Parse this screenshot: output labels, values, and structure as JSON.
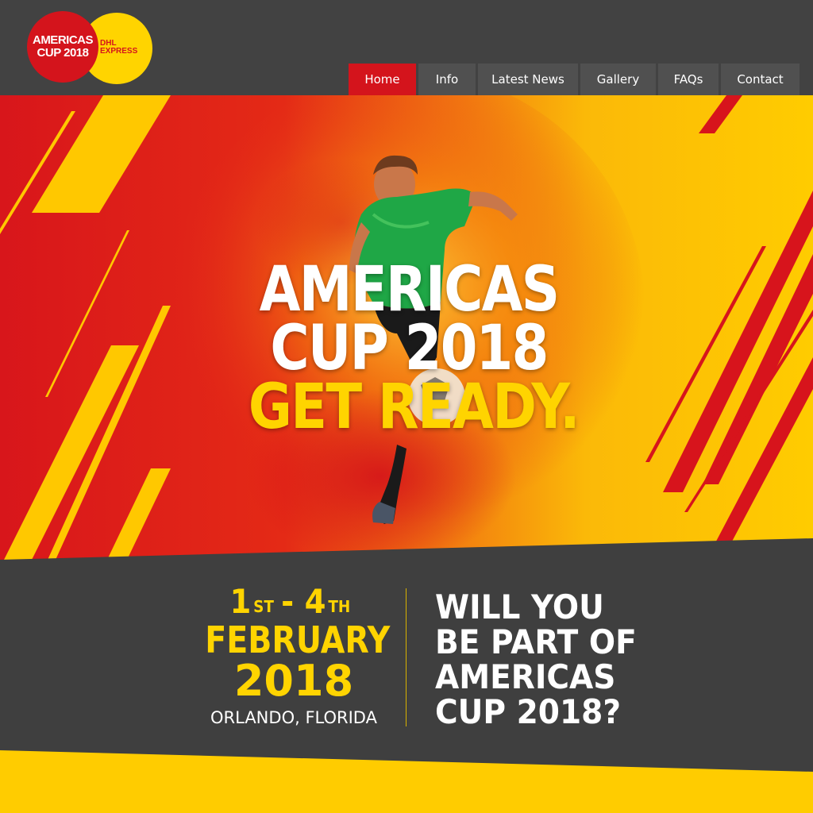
{
  "logo": {
    "red_line1": "AMERICAS",
    "red_line2": "CUP 2018",
    "yellow_line1": "DHL",
    "yellow_line2": "EXPRESS",
    "colors": {
      "red": "#d4141c",
      "yellow": "#ffd400"
    }
  },
  "nav": {
    "items": [
      {
        "label": "Home",
        "active": true
      },
      {
        "label": "Info",
        "active": false
      },
      {
        "label": "Latest News",
        "active": false
      },
      {
        "label": "Gallery",
        "active": false
      },
      {
        "label": "FAQs",
        "active": false
      },
      {
        "label": "Contact",
        "active": false
      }
    ]
  },
  "hero": {
    "line1": "AMERICAS",
    "line2": "CUP 2018",
    "line3": "GET READY.",
    "image_subject": "soccer player kicking ball in red and yellow smoke"
  },
  "event": {
    "start_day": "1",
    "start_suffix": "ST",
    "separator": "-",
    "end_day": "4",
    "end_suffix": "TH",
    "month": "FEBRUARY",
    "year": "2018",
    "location": "ORLANDO, FLORIDA"
  },
  "cta": {
    "line1": "WILL YOU",
    "line2": "BE PART OF",
    "line3": "AMERICAS",
    "line4": "CUP 2018?"
  },
  "colors": {
    "header_bg": "#424242",
    "nav_item_bg": "#505050",
    "nav_active_bg": "#d4141c",
    "accent_red": "#d4141c",
    "accent_yellow": "#ffd400",
    "band_bg": "#3f3f3f"
  }
}
